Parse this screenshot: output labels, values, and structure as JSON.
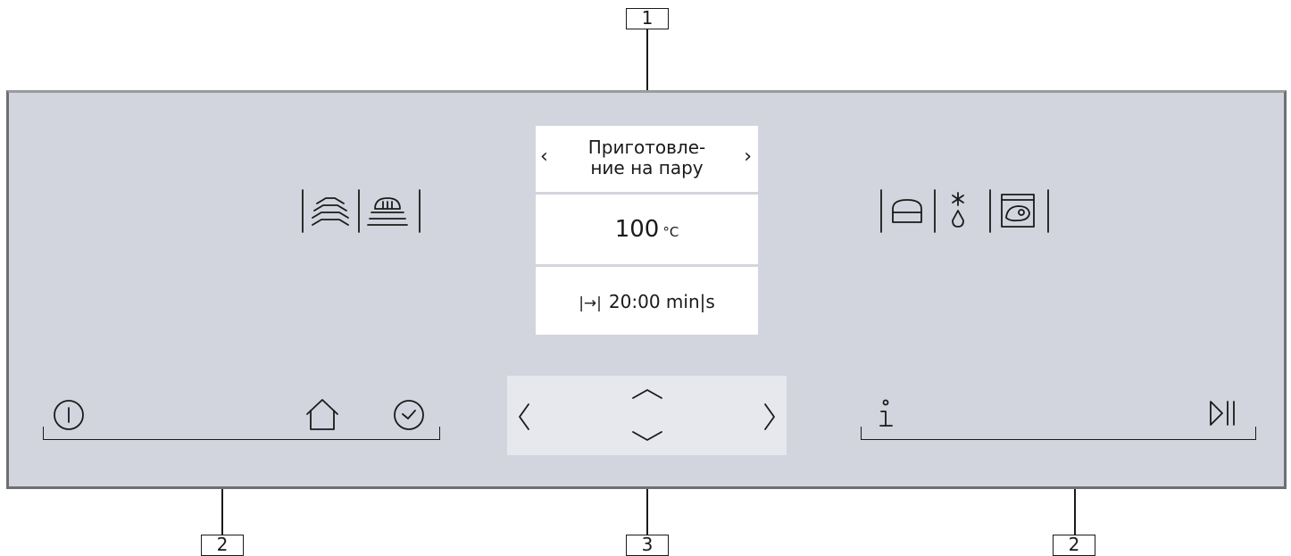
{
  "callouts": {
    "display": "1",
    "sensor_left": "2",
    "sensor_right": "2",
    "navigation": "3"
  },
  "display": {
    "mode_line1": "Приготовле-",
    "mode_line2": "ние на пару",
    "temperature_value": "100",
    "temperature_unit": "°C",
    "duration_symbol": "|→|",
    "duration_value": "20:00 min|s",
    "prev_arrow": "‹",
    "next_arrow": "›"
  },
  "icons": {
    "top_left": [
      "steam-icon",
      "steam-cooking-icon"
    ],
    "top_right": [
      "oven-cavity-icon",
      "defrost-icon",
      "food-package-icon"
    ],
    "bottom_left": [
      "power-icon",
      "home-icon",
      "timer-icon"
    ],
    "navigation": [
      "arrow-left-icon",
      "arrow-up-icon",
      "arrow-down-icon",
      "arrow-right-icon"
    ],
    "bottom_right": [
      "info-icon",
      "play-pause-icon"
    ]
  },
  "colors": {
    "panel": "#d2d5dd",
    "panel_border": "#6e6f72",
    "display_bg": "#ffffff",
    "nav_bg": "#e6e8ee",
    "ink": "#1a1a1a"
  }
}
